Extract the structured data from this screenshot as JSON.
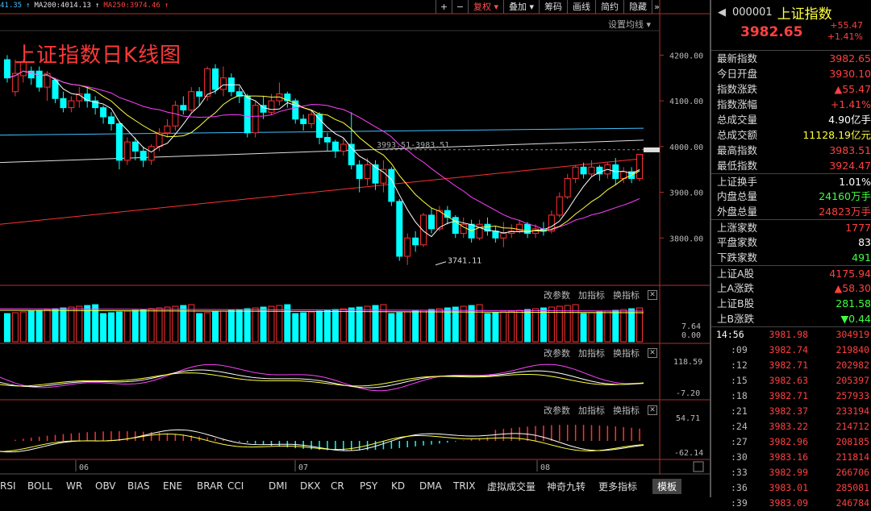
{
  "ma_legend": [
    {
      "text": "41.35",
      "color": "#40c0ff"
    },
    {
      "text": "↑",
      "color": "#40c0ff"
    },
    {
      "text": "MA200:4014.13",
      "color": "#e0e0e0"
    },
    {
      "text": "↑",
      "color": "#e0e0e0"
    },
    {
      "text": "MA250:3974.46",
      "color": "#ff4040"
    },
    {
      "text": "↑",
      "color": "#ff4040"
    }
  ],
  "title": "上证指数日K线图",
  "toolbar": {
    "plus": "+",
    "minus": "−",
    "fuquan": "复权",
    "fuquan_arrow": "▾",
    "diejia": "叠加",
    "diejia_arrow": "▾",
    "chouma": "筹码",
    "huaxian": "画线",
    "jianyue": "简约",
    "yincang": "隐藏",
    "more": "»"
  },
  "set_ma": "设置均线 ▾",
  "price_axis": [
    "4200.00",
    "4100.00",
    "4000.00",
    "3900.00",
    "3800.00"
  ],
  "annotations": {
    "high": "3993.51-3983.51",
    "low": "3741.11"
  },
  "panel_buttons": {
    "change": "改参数",
    "add": "加指标",
    "swap": "换指标",
    "close": "✕"
  },
  "vol_axis": [
    "7.64",
    "0.00"
  ],
  "osc_axis": [
    "118.59",
    "-7.20"
  ],
  "macd_axis": [
    "54.71",
    "-62.14"
  ],
  "date_labels": [
    {
      "text": "06"
    },
    {
      "text": "07"
    },
    {
      "text": "08"
    }
  ],
  "tabs": [
    "RSI",
    "BOLL",
    "WR",
    "OBV",
    "BIAS",
    "ENE",
    "BRAR",
    "CCI",
    "DMI",
    "DKX",
    "CR",
    "PSY",
    "KD",
    "DMA",
    "TRIX",
    "虚拟成交量",
    "神奇九转",
    "更多指标",
    "模板"
  ],
  "stock": {
    "code": "000001",
    "name": "上证指数",
    "price": "3982.65",
    "change": "+55.47",
    "pct": "+1.41%"
  },
  "stats": [
    {
      "label": "最新指数",
      "value": "3982.65",
      "color": "#ff4040"
    },
    {
      "label": "今日开盘",
      "value": "3930.10",
      "color": "#ff4040"
    },
    {
      "label": "指数涨跌",
      "value": "▲55.47",
      "color": "#ff4040"
    },
    {
      "label": "指数涨幅",
      "value": "+1.41%",
      "color": "#ff4040"
    },
    {
      "label": "总成交量",
      "value": "4.90亿手",
      "color": "#ffffff"
    },
    {
      "label": "总成交额",
      "value": "11128.19亿元",
      "color": "#ffff40"
    },
    {
      "label": "最高指数",
      "value": "3983.51",
      "color": "#ff4040"
    },
    {
      "label": "最低指数",
      "value": "3924.47",
      "color": "#ff4040"
    },
    {
      "label": "上证换手",
      "value": "1.01%",
      "color": "#ffffff"
    },
    {
      "label": "内盘总量",
      "value": "24160万手",
      "color": "#40ff40"
    },
    {
      "label": "外盘总量",
      "value": "24823万手",
      "color": "#ff4040"
    },
    {
      "label": "上涨家数",
      "value": "1777",
      "color": "#ff4040"
    },
    {
      "label": "平盘家数",
      "value": "83",
      "color": "#ffffff"
    },
    {
      "label": "下跌家数",
      "value": "491",
      "color": "#40ff40"
    },
    {
      "label": "上证A股",
      "value": "4175.94",
      "color": "#ff4040"
    },
    {
      "label": "上A涨跌",
      "value": "▲58.30",
      "color": "#ff4040"
    },
    {
      "label": "上证B股",
      "value": "281.58",
      "color": "#40ff40"
    },
    {
      "label": "上B涨跌",
      "value": "▼0.44",
      "color": "#40ff40"
    }
  ],
  "ticks": [
    {
      "t": "14:56",
      "p": "3981.98",
      "v": "304919"
    },
    {
      "t": ":09",
      "p": "3982.74",
      "v": "219840"
    },
    {
      "t": ":12",
      "p": "3982.71",
      "v": "202982"
    },
    {
      "t": ":15",
      "p": "3982.63",
      "v": "205397"
    },
    {
      "t": ":18",
      "p": "3982.71",
      "v": "257933"
    },
    {
      "t": ":21",
      "p": "3982.37",
      "v": "233194"
    },
    {
      "t": ":24",
      "p": "3983.22",
      "v": "214712"
    },
    {
      "t": ":27",
      "p": "3982.96",
      "v": "208185"
    },
    {
      "t": ":30",
      "p": "3983.16",
      "v": "211814"
    },
    {
      "t": ":33",
      "p": "3982.99",
      "v": "266706"
    },
    {
      "t": ":36",
      "p": "3983.01",
      "v": "285081"
    },
    {
      "t": ":39",
      "p": "3983.09",
      "v": "246784"
    }
  ],
  "chart_data": {
    "type": "candlestick",
    "y_range": [
      3700,
      4250
    ],
    "candles": [
      [
        4190,
        4150,
        4200,
        4140
      ],
      [
        4120,
        4160,
        4190,
        4110
      ],
      [
        4155,
        4185,
        4190,
        4140
      ],
      [
        4165,
        4150,
        4175,
        4135
      ],
      [
        4165,
        4130,
        4175,
        4120
      ],
      [
        4130,
        4160,
        4165,
        4100
      ],
      [
        4145,
        4105,
        4150,
        4095
      ],
      [
        4105,
        4085,
        4120,
        4075
      ],
      [
        4085,
        4100,
        4110,
        4075
      ],
      [
        4100,
        4115,
        4130,
        4085
      ],
      [
        4115,
        4100,
        4130,
        4085
      ],
      [
        4100,
        4085,
        4110,
        4070
      ],
      [
        4085,
        4065,
        4090,
        4050
      ],
      [
        4065,
        4050,
        4075,
        4035
      ],
      [
        4050,
        3970,
        4055,
        3950
      ],
      [
        3970,
        4010,
        4020,
        3960
      ],
      [
        4010,
        3990,
        4020,
        3970
      ],
      [
        3990,
        3970,
        4000,
        3955
      ],
      [
        3970,
        4000,
        4005,
        3960
      ],
      [
        4000,
        4030,
        4040,
        3990
      ],
      [
        4030,
        4045,
        4060,
        4020
      ],
      [
        4045,
        4090,
        4100,
        4035
      ],
      [
        4090,
        4080,
        4110,
        4070
      ],
      [
        4080,
        4120,
        4130,
        4075
      ],
      [
        4120,
        4110,
        4130,
        4090
      ],
      [
        4110,
        4170,
        4175,
        4100
      ],
      [
        4170,
        4125,
        4180,
        4115
      ],
      [
        4125,
        4150,
        4175,
        4110
      ],
      [
        4150,
        4120,
        4160,
        4110
      ],
      [
        4120,
        4110,
        4130,
        4095
      ],
      [
        4110,
        4030,
        4115,
        4020
      ],
      [
        4030,
        4090,
        4100,
        4020
      ],
      [
        4090,
        4075,
        4110,
        4060
      ],
      [
        4075,
        4100,
        4115,
        4070
      ],
      [
        4100,
        4115,
        4140,
        4090
      ],
      [
        4115,
        4100,
        4120,
        4085
      ],
      [
        4100,
        4060,
        4105,
        4050
      ],
      [
        4060,
        4050,
        4070,
        4035
      ],
      [
        4050,
        4070,
        4080,
        4040
      ],
      [
        4070,
        4020,
        4075,
        4005
      ],
      [
        4020,
        4010,
        4030,
        3990
      ],
      [
        4010,
        3990,
        4015,
        3975
      ],
      [
        3990,
        4005,
        4020,
        3980
      ],
      [
        4005,
        3960,
        4075,
        3950
      ],
      [
        3960,
        3930,
        3970,
        3900
      ],
      [
        3930,
        3960,
        3975,
        3915
      ],
      [
        3960,
        3920,
        3970,
        3905
      ],
      [
        3920,
        3950,
        3970,
        3900
      ],
      [
        3950,
        3880,
        3955,
        3870
      ],
      [
        3880,
        3760,
        3885,
        3750
      ],
      [
        3760,
        3800,
        3810,
        3741
      ],
      [
        3800,
        3785,
        3815,
        3770
      ],
      [
        3785,
        3850,
        3855,
        3780
      ],
      [
        3850,
        3820,
        3865,
        3810
      ],
      [
        3820,
        3860,
        3870,
        3815
      ],
      [
        3860,
        3845,
        3870,
        3830
      ],
      [
        3845,
        3810,
        3850,
        3800
      ],
      [
        3810,
        3830,
        3845,
        3800
      ],
      [
        3830,
        3800,
        3840,
        3790
      ],
      [
        3800,
        3830,
        3840,
        3795
      ],
      [
        3830,
        3815,
        3845,
        3805
      ],
      [
        3815,
        3800,
        3825,
        3790
      ],
      [
        3800,
        3810,
        3835,
        3780
      ],
      [
        3810,
        3815,
        3830,
        3800
      ],
      [
        3815,
        3830,
        3840,
        3810
      ],
      [
        3830,
        3810,
        3835,
        3800
      ],
      [
        3810,
        3820,
        3830,
        3800
      ],
      [
        3820,
        3815,
        3835,
        3805
      ],
      [
        3815,
        3850,
        3860,
        3810
      ],
      [
        3850,
        3890,
        3900,
        3845
      ],
      [
        3890,
        3930,
        3940,
        3885
      ],
      [
        3930,
        3955,
        3960,
        3920
      ],
      [
        3955,
        3940,
        3965,
        3930
      ],
      [
        3940,
        3955,
        3970,
        3935
      ],
      [
        3955,
        3940,
        3960,
        3925
      ],
      [
        3940,
        3960,
        3965,
        3930
      ],
      [
        3960,
        3930,
        3975,
        3915
      ],
      [
        3930,
        3945,
        3955,
        3920
      ],
      [
        3945,
        3930,
        3955,
        3920
      ],
      [
        3930,
        3983,
        3984,
        3924
      ]
    ]
  }
}
